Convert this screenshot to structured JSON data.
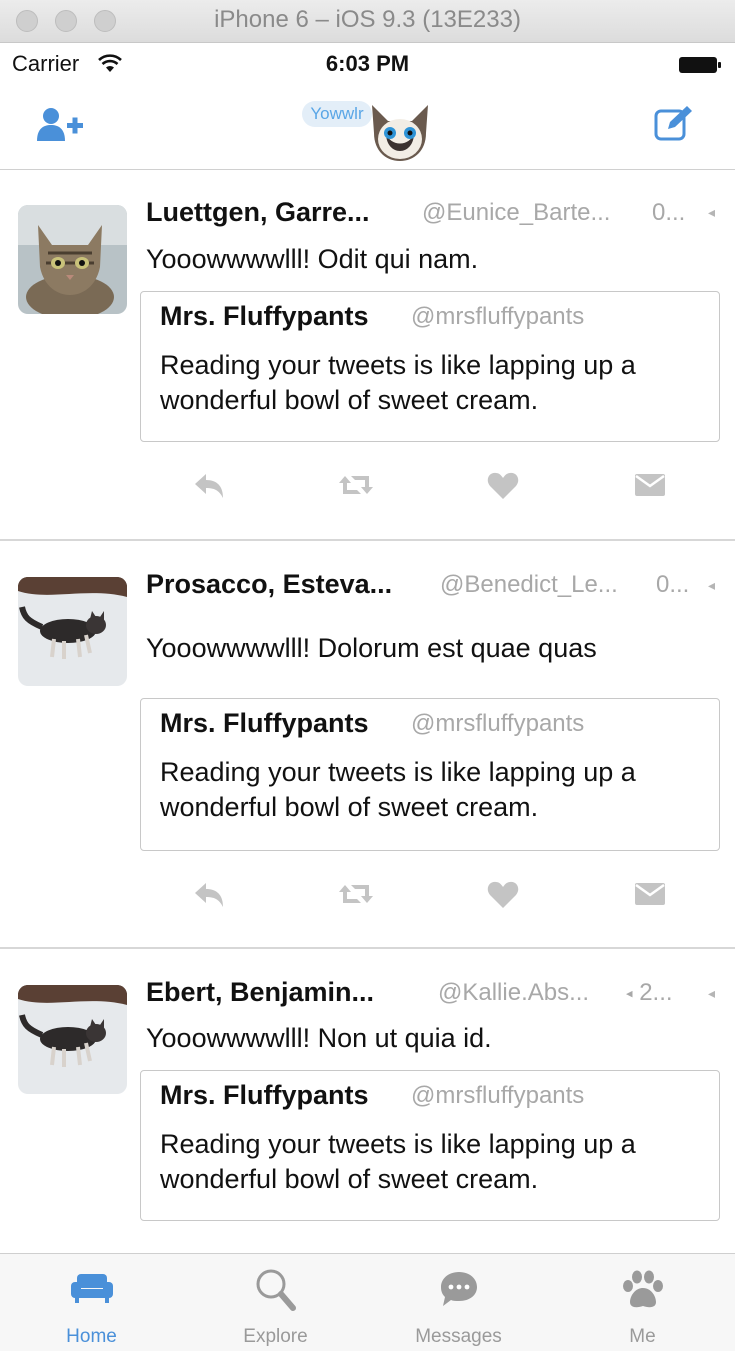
{
  "window": {
    "title": "iPhone 6 – iOS 9.3 (13E233)"
  },
  "status_bar": {
    "carrier": "Carrier",
    "time": "6:03 PM"
  },
  "nav": {
    "logo_text": "Yowwlr",
    "left_icon": "add-user-icon",
    "right_icon": "compose-icon"
  },
  "colors": {
    "accent": "#4a90d9",
    "inactive": "#9a9a9a"
  },
  "tweets": [
    {
      "name": "Luettgen, Garre...",
      "handle": "@Eunice_Barte...",
      "time": "0...",
      "text": "Yooowwwwlll! Odit qui nam.",
      "quote": {
        "name": "Mrs. Fluffypants",
        "handle": "@mrsfluffypants",
        "text": "Reading your tweets is like lapping up a wonderful bowl of sweet cream."
      }
    },
    {
      "name": "Prosacco, Esteva...",
      "handle": "@Benedict_Le...",
      "time": "0...",
      "text": "Yooowwwwlll! Dolorum est quae quas",
      "quote": {
        "name": "Mrs. Fluffypants",
        "handle": "@mrsfluffypants",
        "text": "Reading your tweets is like lapping up a wonderful bowl of sweet cream."
      }
    },
    {
      "name": "Ebert, Benjamin...",
      "handle": "@Kallie.Abs...",
      "time": "2...",
      "text": "Yooowwwwlll! Non ut quia id.",
      "quote": {
        "name": "Mrs. Fluffypants",
        "handle": "@mrsfluffypants",
        "text": "Reading your tweets is like lapping up a wonderful bowl of sweet cream."
      }
    }
  ],
  "tabs": [
    {
      "label": "Home",
      "icon": "couch-icon",
      "active": true
    },
    {
      "label": "Explore",
      "icon": "search-icon",
      "active": false
    },
    {
      "label": "Messages",
      "icon": "chat-bubble-icon",
      "active": false
    },
    {
      "label": "Me",
      "icon": "paw-icon",
      "active": false
    }
  ]
}
